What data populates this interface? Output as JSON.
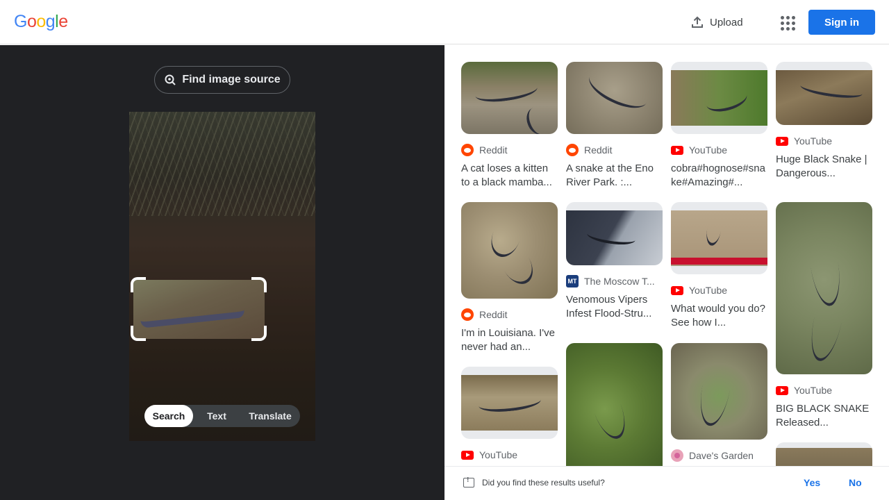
{
  "header": {
    "logo": [
      "G",
      "o",
      "o",
      "g",
      "l",
      "e"
    ],
    "upload_label": "Upload",
    "signin_label": "Sign in"
  },
  "lens": {
    "find_source_label": "Find image source",
    "modes": [
      "Search",
      "Text",
      "Translate"
    ],
    "active_mode": "Search"
  },
  "results": [
    {
      "source": "Reddit",
      "icon": "reddit-icon",
      "title": "A cat loses a kitten to a black mamba..."
    },
    {
      "source": "Reddit",
      "icon": "reddit-icon",
      "title": "A snake at the Eno River Park. :..."
    },
    {
      "source": "YouTube",
      "icon": "youtube-icon",
      "title": "cobra#hognose#snake#Amazing#..."
    },
    {
      "source": "YouTube",
      "icon": "youtube-icon",
      "title": "Huge Black Snake | Dangerous..."
    },
    {
      "source": "Reddit",
      "icon": "reddit-icon",
      "title": "I'm in Louisiana. I've never had an..."
    },
    {
      "source": "The Moscow T...",
      "icon": "moscow-times-icon",
      "title": "Venomous Vipers Infest Flood-Stru..."
    },
    {
      "source": "YouTube",
      "icon": "youtube-icon",
      "title": "What would you do? See how I..."
    },
    {
      "source": "YouTube",
      "icon": "youtube-icon",
      "title": "BIG BLACK SNAKE Released..."
    },
    {
      "source": "YouTube",
      "icon": "youtube-icon",
      "title": ""
    },
    {
      "source": "Dave's Garden",
      "icon": "daves-garden-icon",
      "title": ""
    }
  ],
  "feedback": {
    "question": "Did you find these results useful?",
    "yes_label": "Yes",
    "no_label": "No"
  },
  "colors": {
    "accent": "#1a73e8",
    "left_panel_bg": "#202124",
    "youtube_red": "#ff0000",
    "reddit_orange": "#ff4500"
  }
}
